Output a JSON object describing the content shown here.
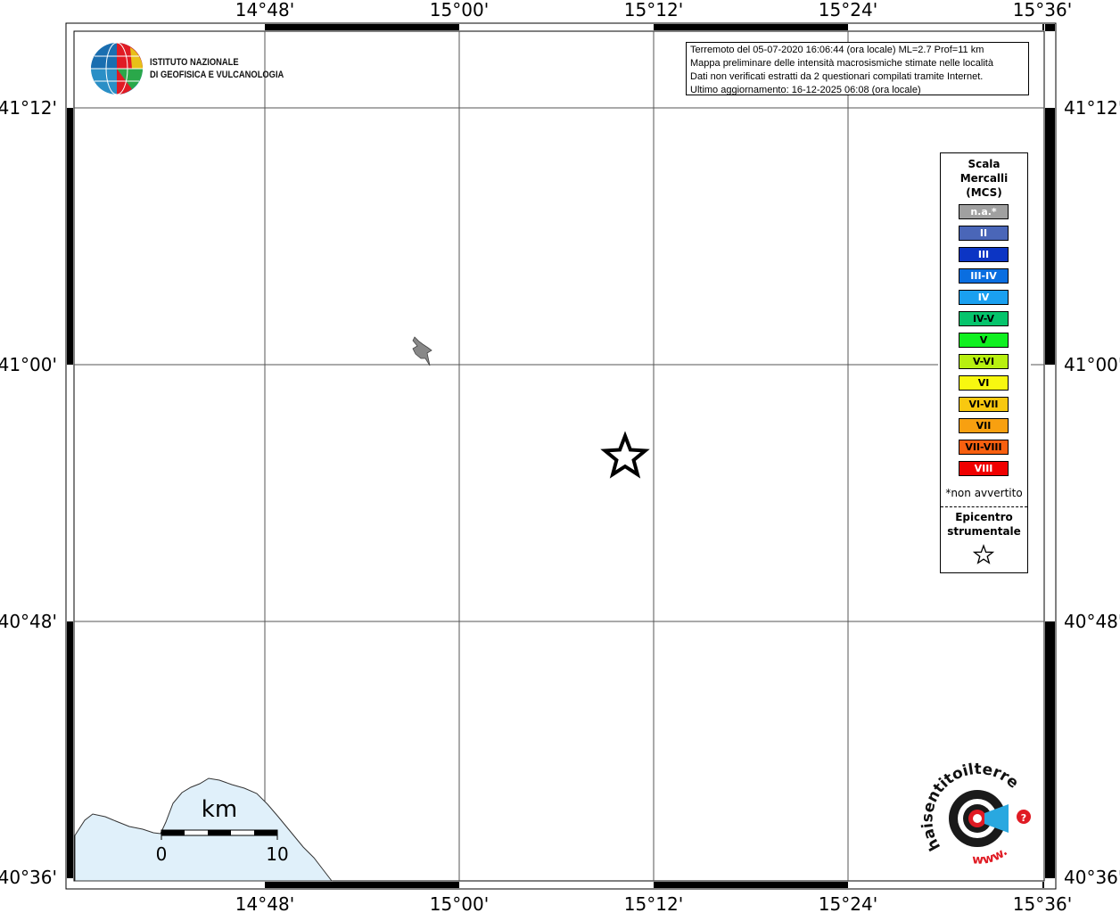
{
  "map": {
    "lon_labels": [
      "14°48'",
      "15°00'",
      "15°12'",
      "15°24'",
      "15°36'"
    ],
    "lat_labels": [
      "41°12'",
      "41°00'",
      "40°48'",
      "40°36'"
    ]
  },
  "logo": {
    "line1": "ISTITUTO NAZIONALE",
    "line2": "DI GEOFISICA E VULCANOLOGIA"
  },
  "info": {
    "line1": "Terremoto del 05-07-2020 16:06:44 (ora locale) ML=2.7 Prof=11 km",
    "line2": "Mappa preliminare delle intensità macrosismiche stimate nelle località",
    "line3": "Dati non verificati estratti da 2 questionari compilati tramite Internet.",
    "line4": "Ultimo aggiornamento: 16-12-2025 06:08 (ora locale)"
  },
  "legend": {
    "title1": "Scala",
    "title2": "Mercalli",
    "title3": "(MCS)",
    "items": [
      {
        "label": "n.a.*",
        "color": "#a0a0a0",
        "text": "#ffffff"
      },
      {
        "label": "II",
        "color": "#4a66b8",
        "text": "#ffffff"
      },
      {
        "label": "III",
        "color": "#0c35c4",
        "text": "#ffffff"
      },
      {
        "label": "III-IV",
        "color": "#0a6ee0",
        "text": "#ffffff"
      },
      {
        "label": "IV",
        "color": "#1aa0f0",
        "text": "#ffffff"
      },
      {
        "label": "IV-V",
        "color": "#06c46c",
        "text": "#000000"
      },
      {
        "label": "V",
        "color": "#10f020",
        "text": "#000000"
      },
      {
        "label": "V-VI",
        "color": "#b8f010",
        "text": "#000000"
      },
      {
        "label": "VI",
        "color": "#f8f810",
        "text": "#000000"
      },
      {
        "label": "VI-VII",
        "color": "#f8c810",
        "text": "#000000"
      },
      {
        "label": "VII",
        "color": "#f8a010",
        "text": "#000000"
      },
      {
        "label": "VII-VIII",
        "color": "#f86010",
        "text": "#000000"
      },
      {
        "label": "VIII",
        "color": "#f00000",
        "text": "#ffffff"
      }
    ],
    "note": "*non avvertito",
    "epi1": "Epicentro",
    "epi2": "strumentale"
  },
  "scale": {
    "unit": "km",
    "zero": "0",
    "ten": "10"
  },
  "hsit": {
    "text": "haisentitoilterremoto.it",
    "www": "www."
  }
}
